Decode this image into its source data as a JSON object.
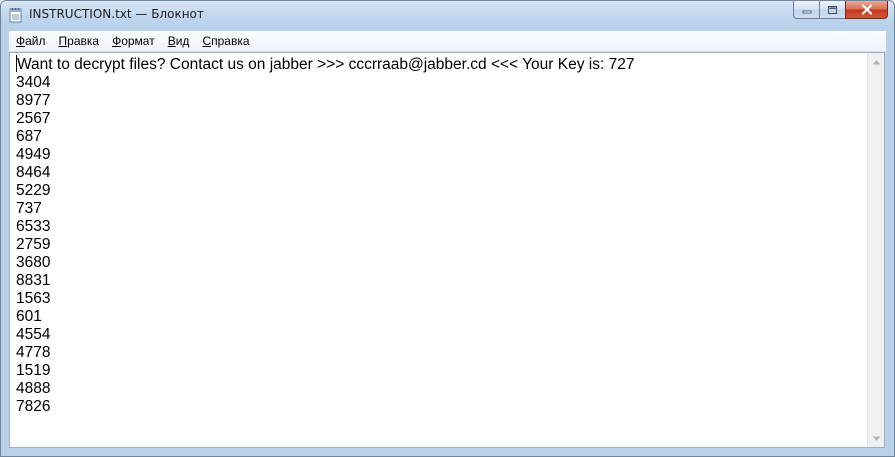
{
  "window": {
    "title": "INSTRUCTION.txt — Блокнот",
    "app_icon": "notepad-icon",
    "buttons": {
      "minimize_icon": "minimize-icon",
      "maximize_icon": "maximize-icon",
      "close_icon": "close-icon"
    }
  },
  "menu": {
    "items": [
      {
        "first": "Ф",
        "rest": "айл"
      },
      {
        "first": "П",
        "rest": "равка"
      },
      {
        "first": "Ф",
        "rest": "ормат"
      },
      {
        "first": "В",
        "rest": "ид"
      },
      {
        "first": "С",
        "rest": "правка"
      }
    ]
  },
  "document": {
    "lines": [
      "Want to decrypt files? Contact us on jabber >>> cccrraab@jabber.cd <<< Your Key is: 727",
      "3404",
      "8977",
      "2567",
      "687",
      "4949",
      "8464",
      "5229",
      "737",
      "6533",
      "2759",
      "3680",
      "8831",
      "1563",
      "601",
      "4554",
      "4778",
      "1519",
      "4888",
      "7826"
    ]
  },
  "colors": {
    "title_bar": "#c0d6ee",
    "close_button": "#c4371b",
    "editor_background": "#ffffff"
  }
}
